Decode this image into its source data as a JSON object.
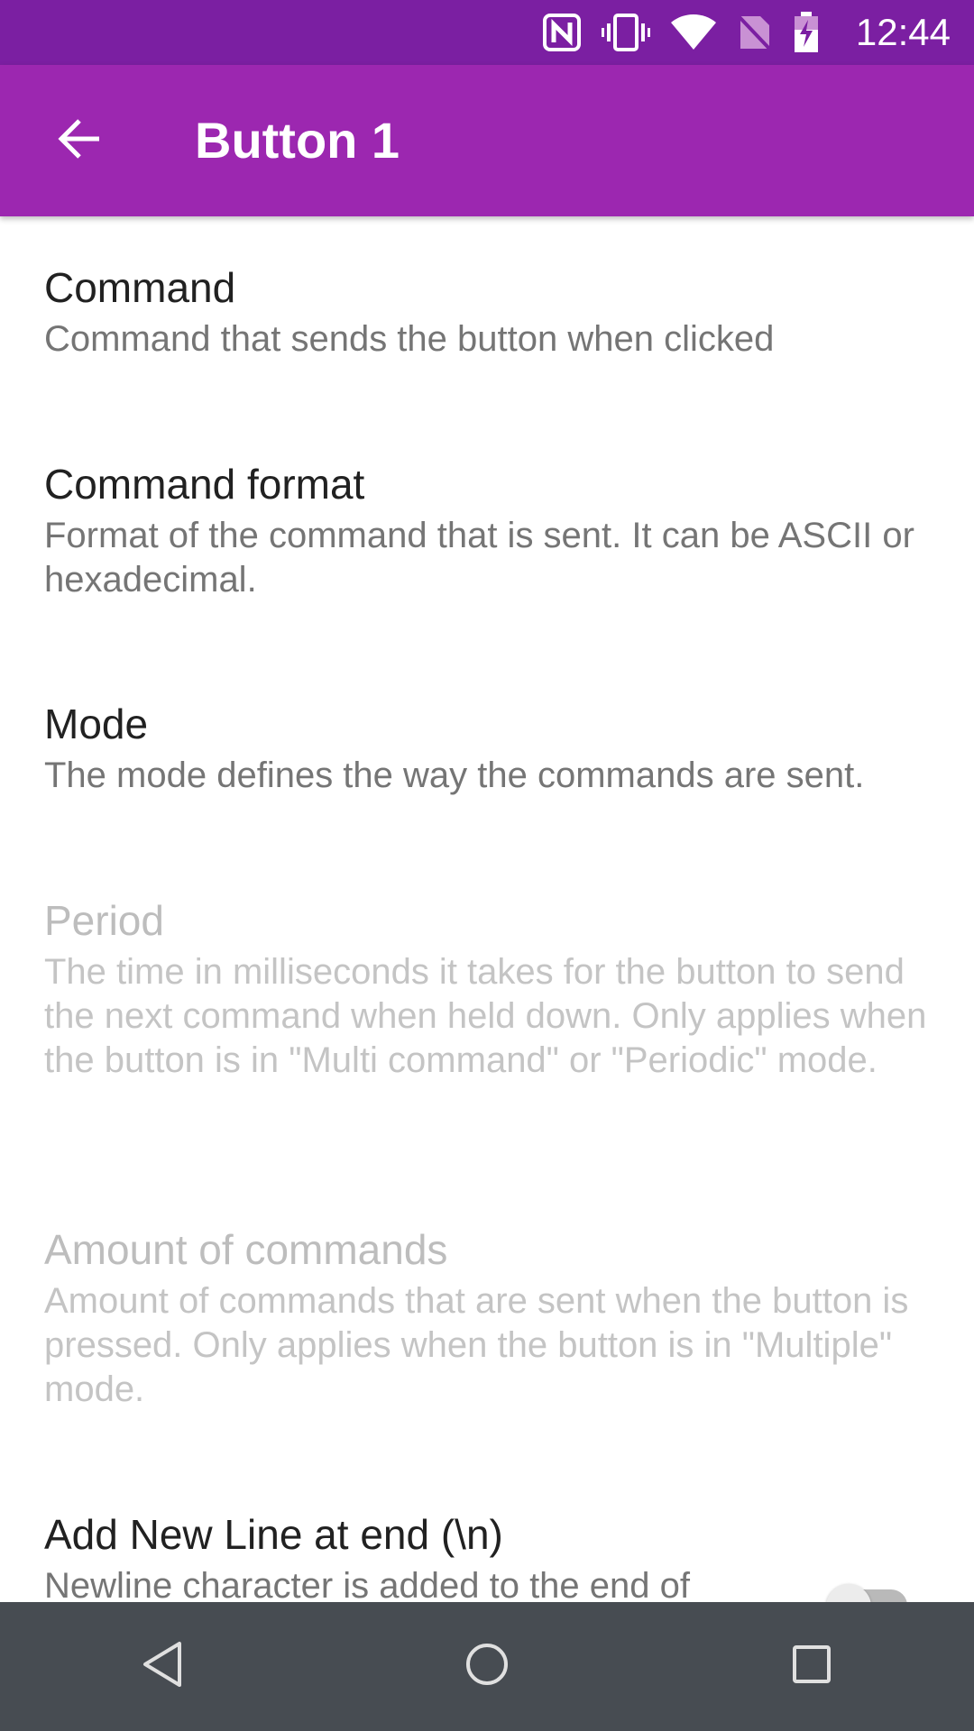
{
  "status_bar": {
    "time": "12:44",
    "icons": [
      "nfc-icon",
      "vibrate-icon",
      "wifi-icon",
      "no-sim-icon",
      "battery-charging-icon"
    ]
  },
  "app_bar": {
    "title": "Button 1",
    "back_icon": "arrow-back-icon"
  },
  "preferences": [
    {
      "title": "Command",
      "summary": "Command that sends the button when clicked",
      "enabled": true
    },
    {
      "title": "Command format",
      "summary": "Format of the command that is sent. It can be ASCII or hexadecimal.",
      "enabled": true
    },
    {
      "title": "Mode",
      "summary": "The mode defines the way the commands are sent.",
      "enabled": true
    },
    {
      "title": "Period",
      "summary": "The time in milliseconds it takes for the button to send the next command when held down. Only applies when the button is in \"Multi command\" or \"Periodic\" mode.",
      "enabled": false
    },
    {
      "title": "Amount of commands",
      "summary": "Amount of commands that are sent when the button is pressed. Only applies when the button is in \"Multiple\" mode.",
      "enabled": false
    },
    {
      "title": "Add New Line at end (\\n)",
      "summary": "Newline character is added to the end of",
      "enabled": true,
      "switch_on": false
    }
  ],
  "nav_bar": {
    "back": "nav-back-icon",
    "home": "nav-home-icon",
    "recents": "nav-recents-icon"
  },
  "colors": {
    "status_bar": "#7b1fa2",
    "app_bar": "#9c27b0",
    "nav_bar": "#474c52"
  }
}
